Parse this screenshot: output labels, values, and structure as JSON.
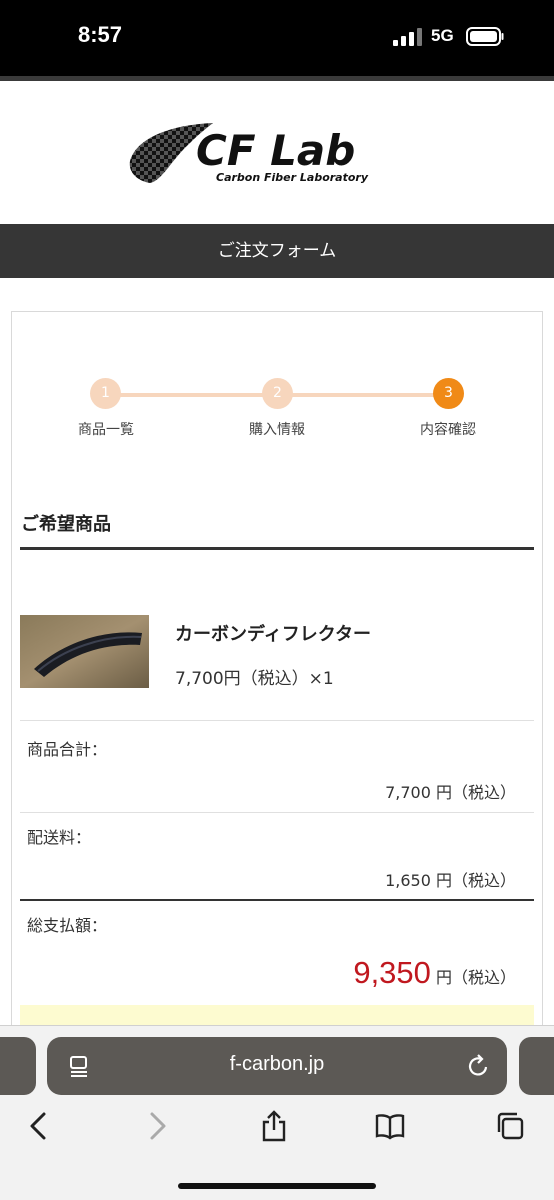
{
  "status_bar": {
    "time": "8:57",
    "network": "5G"
  },
  "brand": {
    "logo_text": "CF Lab",
    "logo_subtitle": "Carbon Fiber Laboratory"
  },
  "page_title": "ご注文フォーム",
  "steps": [
    {
      "number": "1",
      "label": "商品一覧",
      "state": "done"
    },
    {
      "number": "2",
      "label": "購入情報",
      "state": "done"
    },
    {
      "number": "3",
      "label": "内容確認",
      "state": "active"
    }
  ],
  "section_title": "ご希望商品",
  "product": {
    "name": "カーボンディフレクター",
    "price_line": "7,700円（税込）×1"
  },
  "summary": {
    "subtotal_label": "商品合計：",
    "subtotal_value": "7,700 円（税込）",
    "shipping_label": "配送料：",
    "shipping_value": "1,650 円（税込）",
    "total_label": "総支払額：",
    "total_amount": "9,350",
    "total_suffix": " 円（税込）"
  },
  "browser": {
    "url": "f-carbon.jp"
  },
  "colors": {
    "accent": "#f08a17",
    "accent_light": "#f7d6bd",
    "price_red": "#c0181f",
    "header_dark": "#363636"
  },
  "icons": [
    "signal-icon",
    "battery-icon",
    "page-menu-icon",
    "reload-icon",
    "back-icon",
    "forward-icon",
    "share-icon",
    "bookmarks-icon",
    "tabs-icon"
  ]
}
